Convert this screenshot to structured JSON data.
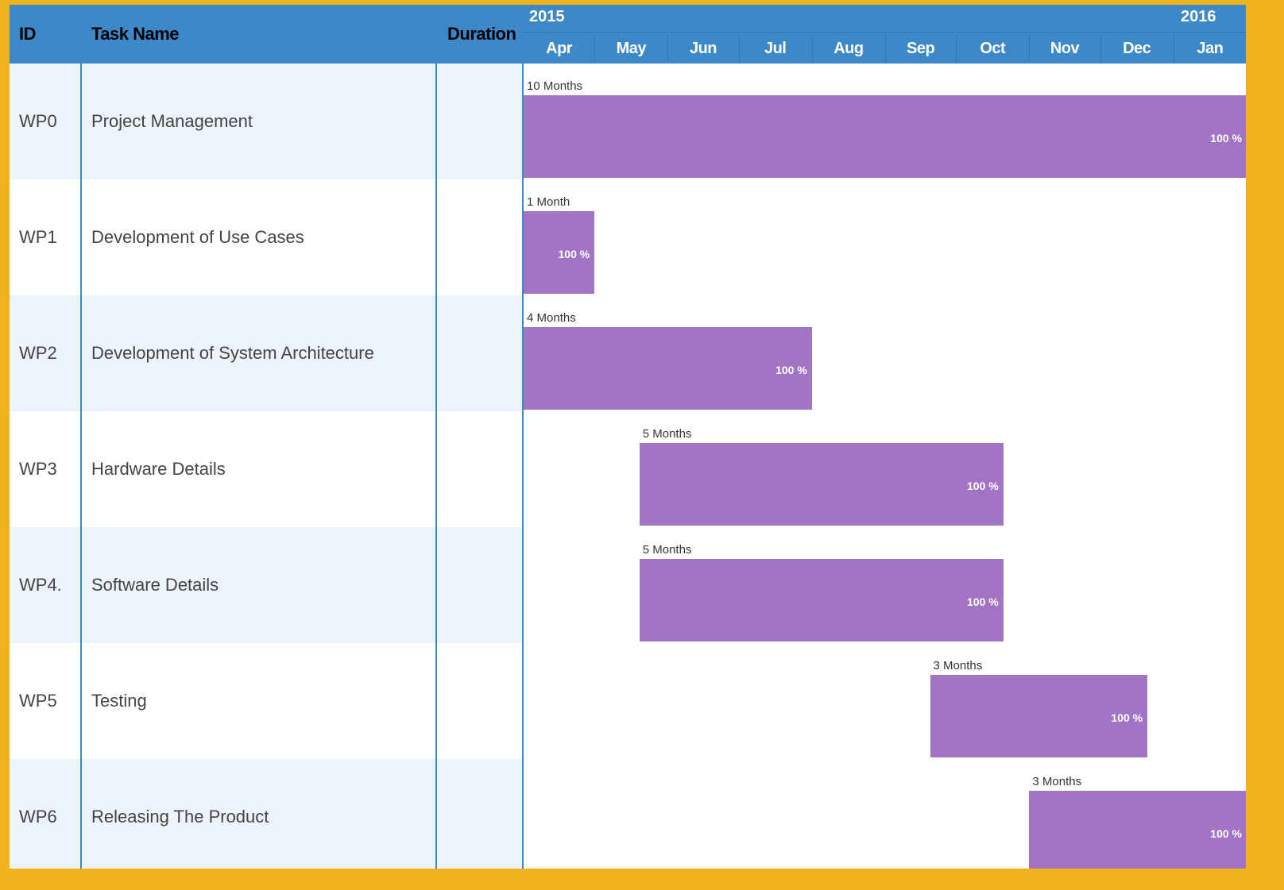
{
  "header": {
    "id_label": "ID",
    "name_label": "Task Name",
    "duration_label": "Duration",
    "years": [
      "2015",
      "2016"
    ],
    "months": [
      "Apr",
      "May",
      "Jun",
      "Jul",
      "Aug",
      "Sep",
      "Oct",
      "Nov",
      "Dec",
      "Jan"
    ]
  },
  "colors": {
    "frame": "#f0b31d",
    "header": "#3d88c8",
    "bar": "#a175c3",
    "row_alt": "#edf3fa"
  },
  "chart_data": {
    "type": "gantt",
    "title": "",
    "x_axis": {
      "years": [
        {
          "label": "2015",
          "start": "2015-04"
        },
        {
          "label": "2016",
          "start": "2016-01"
        }
      ],
      "months": [
        "Apr",
        "May",
        "Jun",
        "Jul",
        "Aug",
        "Sep",
        "Oct",
        "Nov",
        "Dec",
        "Jan"
      ],
      "range": [
        "2015-04-01",
        "2016-01-31"
      ]
    },
    "tasks": [
      {
        "id": "WP0",
        "name": "Project Management",
        "start": "2015-04-01",
        "end": "2016-01-31",
        "duration_label": "10 Months",
        "progress_label": "100 %"
      },
      {
        "id": "WP1",
        "name": "Development of Use Cases",
        "start": "2015-04-01",
        "end": "2015-04-30",
        "duration_label": "1 Month",
        "progress_label": "100 %"
      },
      {
        "id": "WP2",
        "name": "Development of System Architecture",
        "start": "2015-04-01",
        "end": "2015-07-31",
        "duration_label": "4 Months",
        "progress_label": "100 %"
      },
      {
        "id": "WP3",
        "name": "Hardware Details",
        "start": "2015-05-20",
        "end": "2015-10-20",
        "duration_label": "5 Months",
        "progress_label": "100 %"
      },
      {
        "id": "WP4.",
        "name": "Software Details",
        "start": "2015-05-20",
        "end": "2015-10-20",
        "duration_label": "5 Months",
        "progress_label": "100 %"
      },
      {
        "id": "WP5",
        "name": "Testing",
        "start": "2015-09-20",
        "end": "2015-12-20",
        "duration_label": "3 Months",
        "progress_label": "100 %"
      },
      {
        "id": "WP6",
        "name": "Releasing The Product",
        "start": "2015-11-01",
        "end": "2016-01-31",
        "duration_label": "3 Months",
        "progress_label": "100 %"
      }
    ]
  }
}
